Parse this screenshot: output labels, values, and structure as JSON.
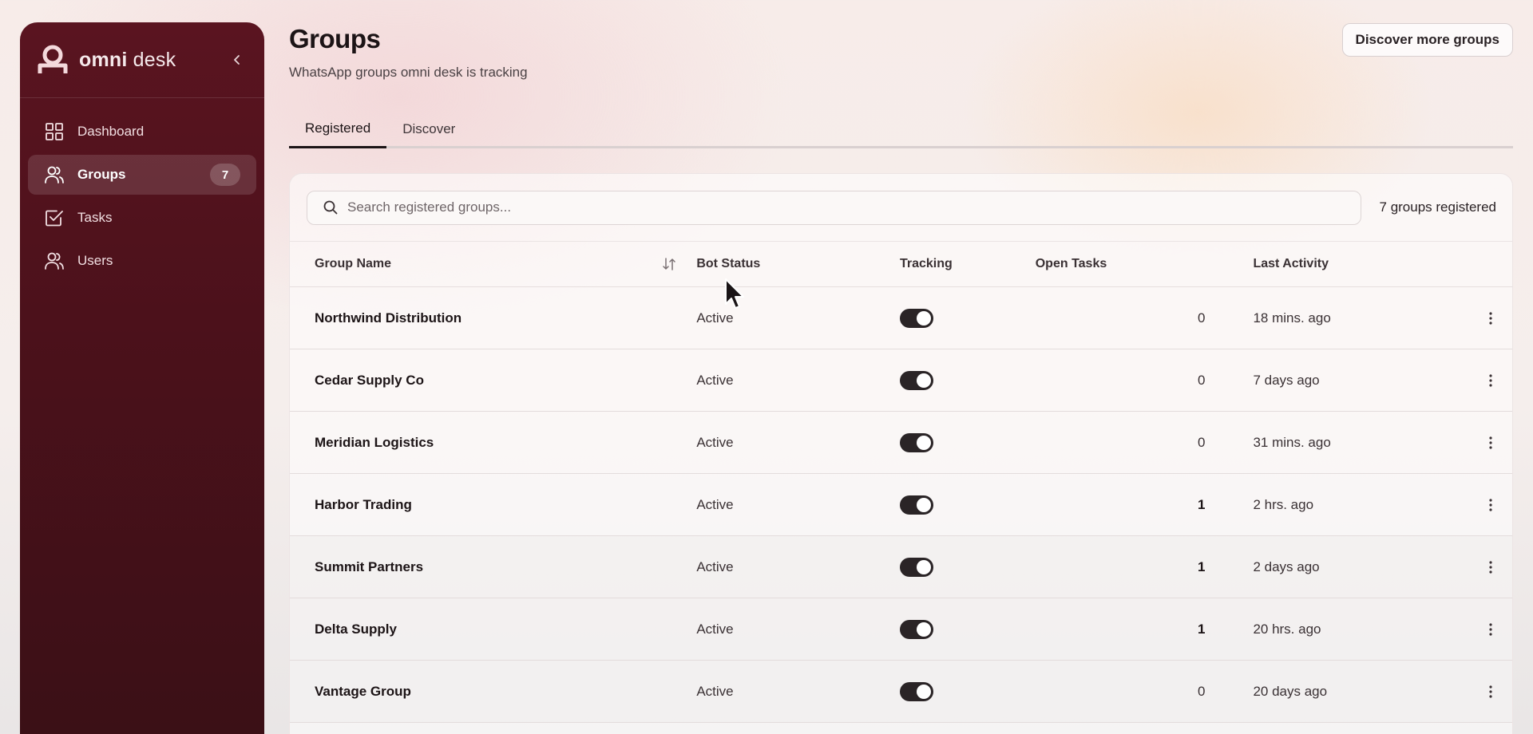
{
  "brand": {
    "name_bold": "omni",
    "name_rest": " desk"
  },
  "sidebar": {
    "items": [
      {
        "label": "Dashboard",
        "icon": "dashboard-icon"
      },
      {
        "label": "Groups",
        "icon": "users-icon",
        "badge": "7",
        "active": true
      },
      {
        "label": "Tasks",
        "icon": "tasks-icon"
      },
      {
        "label": "Users",
        "icon": "users-icon"
      }
    ]
  },
  "header": {
    "title": "Groups",
    "subtitle": "WhatsApp groups omni desk is tracking",
    "discover_button": "Discover more groups"
  },
  "tabs": [
    {
      "label": "Registered",
      "active": true
    },
    {
      "label": "Discover"
    }
  ],
  "search": {
    "placeholder": "Search registered groups...",
    "count_text": "7 groups registered"
  },
  "table": {
    "columns": [
      "Group Name",
      "Bot Status",
      "Tracking",
      "Open Tasks",
      "Last Activity"
    ],
    "rows": [
      {
        "name": "Northwind Distribution",
        "status": "Active",
        "tracking": true,
        "open_tasks": "0",
        "last_activity": "18 mins. ago"
      },
      {
        "name": "Cedar Supply Co",
        "status": "Active",
        "tracking": true,
        "open_tasks": "0",
        "last_activity": "7 days ago"
      },
      {
        "name": "Meridian Logistics",
        "status": "Active",
        "tracking": true,
        "open_tasks": "0",
        "last_activity": "31 mins. ago"
      },
      {
        "name": "Harbor Trading",
        "status": "Active",
        "tracking": true,
        "open_tasks": "1",
        "last_activity": "2 hrs. ago"
      },
      {
        "name": "Summit Partners",
        "status": "Active",
        "tracking": true,
        "open_tasks": "1",
        "last_activity": "2 days ago"
      },
      {
        "name": "Delta Supply",
        "status": "Active",
        "tracking": true,
        "open_tasks": "1",
        "last_activity": "20 hrs. ago"
      },
      {
        "name": "Vantage Group",
        "status": "Active",
        "tracking": true,
        "open_tasks": "0",
        "last_activity": "20 days ago"
      }
    ]
  },
  "colors": {
    "sidebar": "#4c111b",
    "toggle_on": "#2a2426",
    "accent_text": "#1c1416"
  }
}
